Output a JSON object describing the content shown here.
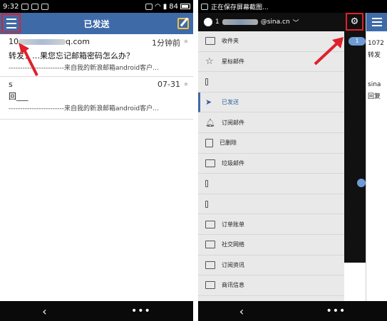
{
  "left_phone": {
    "status": {
      "time": "9:32",
      "battery": "84"
    },
    "title": "已发送",
    "mails": [
      {
        "sender_visible": "10",
        "sender_domain": "q.com",
        "time": "1分钟前",
        "subject": "转发：…果您忘记邮箱密码怎么办？",
        "preview": "------------------------来自我的新浪邮箱android客户..."
      },
      {
        "sender_visible": "s",
        "sender_domain": "",
        "time": "07-31",
        "subject": "回___",
        "preview": "------------------------来自我的新浪邮箱android客户..."
      }
    ],
    "nav": {
      "back": "‹",
      "more": "•••"
    }
  },
  "right_phone": {
    "status_text": "正在保存屏幕截图...",
    "account": {
      "prefix": "1",
      "suffix": "@sina.cn"
    },
    "folders": [
      {
        "label": "收件夹",
        "icon": "mail-icon",
        "badge": "1"
      },
      {
        "label": "星标邮件",
        "icon": "star-icon"
      },
      {
        "label": "",
        "icon": "divider-icon"
      },
      {
        "label": "已发送",
        "icon": "send-icon",
        "active": true
      },
      {
        "label": "订阅邮件",
        "icon": "bell-icon"
      },
      {
        "label": "已删除",
        "icon": "trash-icon"
      },
      {
        "label": "垃圾邮件",
        "icon": "spam-icon"
      },
      {
        "label": "",
        "icon": "draft-icon",
        "toggle": true
      },
      {
        "label": "",
        "icon": "outbox-icon"
      },
      {
        "label": "订单账单",
        "icon": "folder-icon"
      },
      {
        "label": "社交网络",
        "icon": "folder-icon"
      },
      {
        "label": "订阅资讯",
        "icon": "folder-icon"
      },
      {
        "label": "商讯信息",
        "icon": "folder-icon"
      }
    ],
    "peek": {
      "line1": "1072",
      "line2": "sina",
      "line3": "回复"
    },
    "nav": {
      "back": "‹",
      "more": "•••"
    }
  },
  "colors": {
    "header_blue": "#3e6aa8",
    "highlight_red": "#e0202a",
    "badge_blue": "#6e9bd6"
  }
}
